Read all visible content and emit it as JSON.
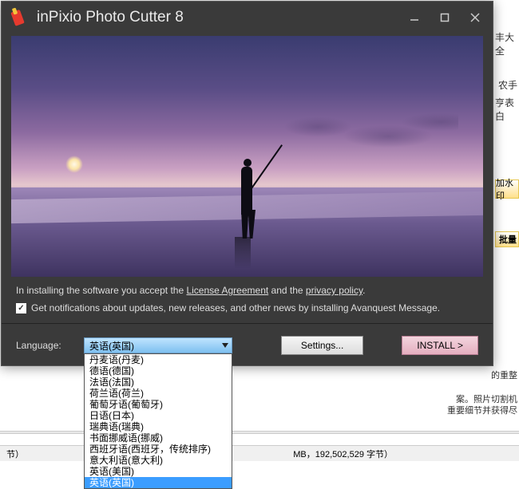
{
  "installer": {
    "title": "inPixio Photo Cutter 8",
    "agree_prefix": "In installing the software you accept the ",
    "license_link": "License Agreement",
    "agree_mid": " and the ",
    "privacy_link": "privacy policy",
    "agree_suffix": ".",
    "checkbox_checked": true,
    "checkbox_label": "Get notifications about updates, new releases, and other news by installing Avanquest Message.",
    "language_label": "Language:",
    "selected_language": "英语(英国)",
    "language_options": [
      "丹麦语(丹麦)",
      "德语(德国)",
      "法语(法国)",
      "荷兰语(荷兰)",
      "葡萄牙语(葡萄牙)",
      "日语(日本)",
      "瑞典语(瑞典)",
      "书面挪威语(挪威)",
      "西班牙语(西班牙，传统排序)",
      "意大利语(意大利)",
      "英语(美国)",
      "英语(英国)"
    ],
    "settings_button": "Settings...",
    "install_button": "INSTALL >"
  },
  "background": {
    "right_texts": [
      "丰大全",
      "农手",
      "亨表白"
    ],
    "yellow1": "加水印",
    "yellow2": "批量",
    "mid1": "的重整",
    "mid2": "案。照片切割机",
    "mid3": "重要细节并获得尽",
    "status_left": "节）",
    "status_right": "MB，192,502,529 字节）"
  }
}
